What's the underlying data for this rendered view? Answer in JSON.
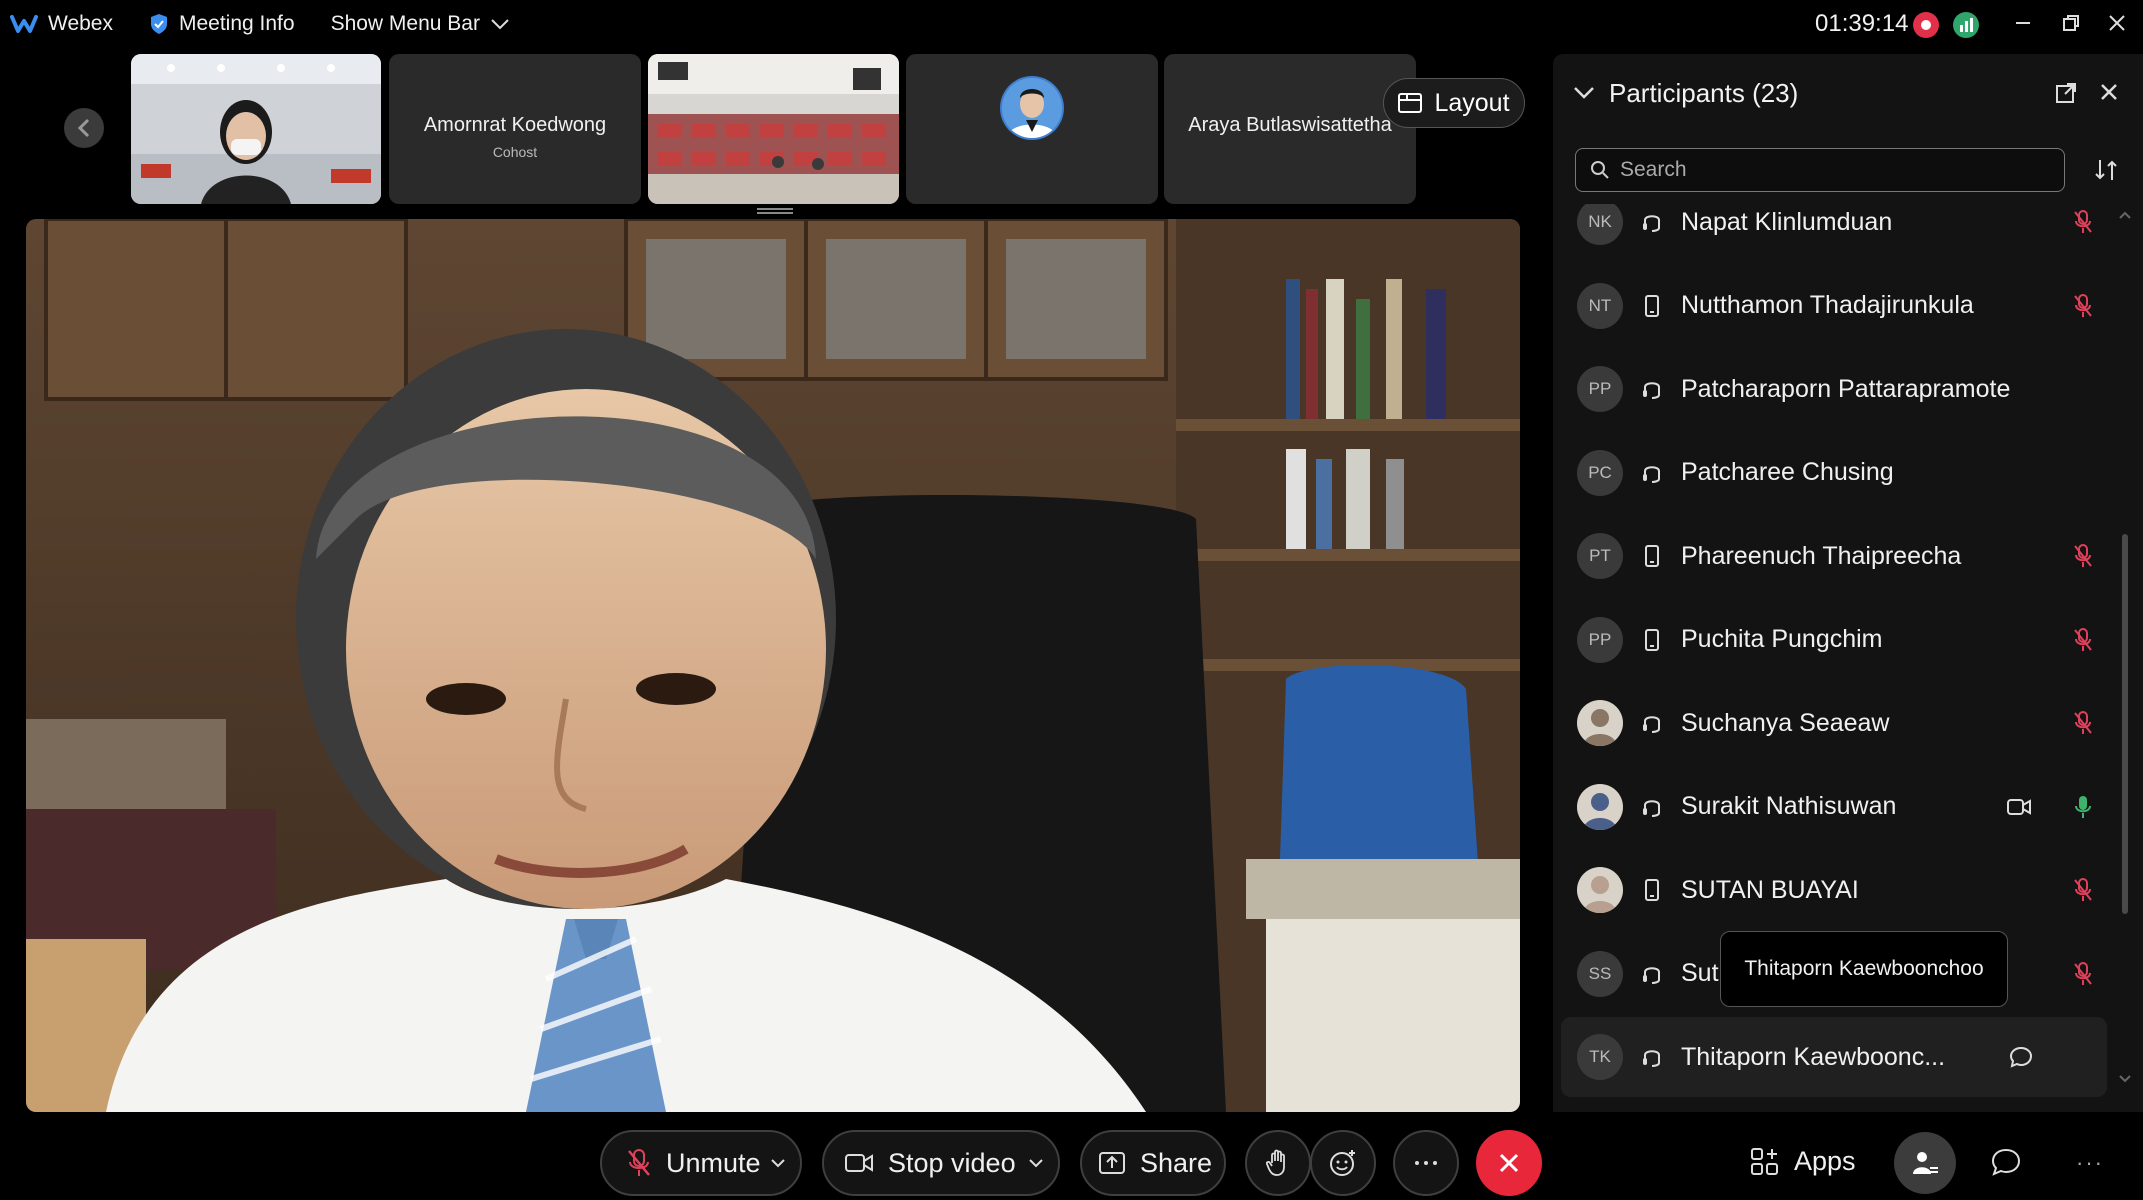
{
  "topbar": {
    "app_name": "Webex",
    "meeting_info": "Meeting Info",
    "show_menu_bar": "Show Menu Bar",
    "clock": "01:39:14"
  },
  "thumbnails": [
    {
      "type": "video",
      "scene": "woman-with-mask"
    },
    {
      "type": "name",
      "name": "Amornrat Koedwong",
      "role": "Cohost"
    },
    {
      "type": "video",
      "scene": "auditorium"
    },
    {
      "type": "avatar"
    },
    {
      "type": "name",
      "name": "Araya Butlaswisattetha"
    }
  ],
  "layout_button": "Layout",
  "panel": {
    "title": "Participants (23)",
    "search_placeholder": "Search"
  },
  "participants": [
    {
      "initials": "NK",
      "name": "Napat Klinlumduan",
      "device": "headset",
      "status": "mic-off",
      "color_avatar": false
    },
    {
      "initials": "NT",
      "name": "Nutthamon Thadajirunkula",
      "device": "mobile",
      "status": "mic-off",
      "color_avatar": false
    },
    {
      "initials": "PP",
      "name": "Patcharaporn Pattarapramote",
      "device": "headset",
      "status": "none",
      "color_avatar": false
    },
    {
      "initials": "PC",
      "name": "Patcharee Chusing",
      "device": "headset",
      "status": "none",
      "color_avatar": false
    },
    {
      "initials": "PT",
      "name": "Phareenuch Thaipreecha",
      "device": "mobile",
      "status": "mic-off",
      "color_avatar": false
    },
    {
      "initials": "PP",
      "name": "Puchita Pungchim",
      "device": "mobile",
      "status": "mic-off",
      "color_avatar": false
    },
    {
      "initials": "",
      "name": "Suchanya Seaeaw",
      "device": "headset",
      "status": "mic-off",
      "color_avatar": true
    },
    {
      "initials": "",
      "name": "Surakit Nathisuwan",
      "device": "headset",
      "status": "mic-on",
      "camera": true,
      "color_avatar": true
    },
    {
      "initials": "",
      "name": "SUTAN BUAYAI",
      "device": "mobile",
      "status": "mic-off",
      "color_avatar": true
    },
    {
      "initials": "SS",
      "name": "Sut",
      "device": "headset",
      "status": "mic-off",
      "color_avatar": false
    },
    {
      "initials": "TK",
      "name": "Thitaporn Kaewboonc...",
      "device": "headset",
      "status": "chat",
      "color_avatar": false,
      "selected": true
    }
  ],
  "tooltip": "Thitaporn Kaewboonchoo",
  "controls": {
    "unmute": "Unmute",
    "stop_video": "Stop video",
    "share": "Share",
    "apps": "Apps"
  },
  "colors": {
    "end_call": "#e8283a",
    "mic_off": "#e0405a",
    "mic_on": "#3fb36d",
    "record": "#e3304a"
  }
}
